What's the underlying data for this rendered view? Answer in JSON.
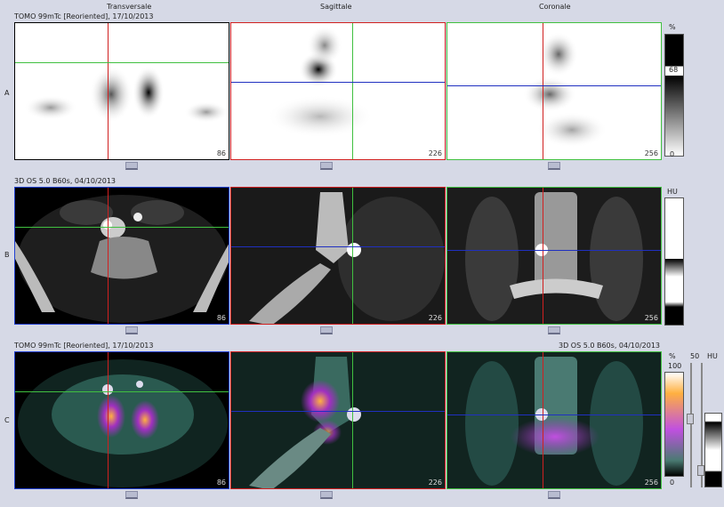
{
  "columns": {
    "col1": "Transversale",
    "col2": "Sagittale",
    "col3": "Coronale"
  },
  "rows": {
    "a": {
      "letter": "A",
      "series": "TOMO 99mTc [Reoriented], 17/10/2013"
    },
    "b": {
      "letter": "B",
      "series": "3D  OS  5.0  B60s, 04/10/2013"
    },
    "c": {
      "letter": "C",
      "series_left": "TOMO 99mTc [Reoriented], 17/10/2013",
      "series_right": "3D  OS  5.0  B60s, 04/10/2013"
    }
  },
  "slices": {
    "a": [
      "86",
      "226",
      "256"
    ],
    "b": [
      "86",
      "226",
      "256"
    ],
    "c": [
      "86",
      "226",
      "256"
    ]
  },
  "colorbars": {
    "a": {
      "unit": "%",
      "mid": "68",
      "min": "0"
    },
    "b": {
      "unit": "HU"
    },
    "c": {
      "unit": "%",
      "max": "100",
      "min": "0",
      "fifty": "50",
      "unit2": "HU"
    }
  },
  "colors": {
    "crosshair_red": "#d02020",
    "crosshair_green": "#40c040",
    "crosshair_blue": "#2030c0",
    "background": "#d6d9e6"
  }
}
